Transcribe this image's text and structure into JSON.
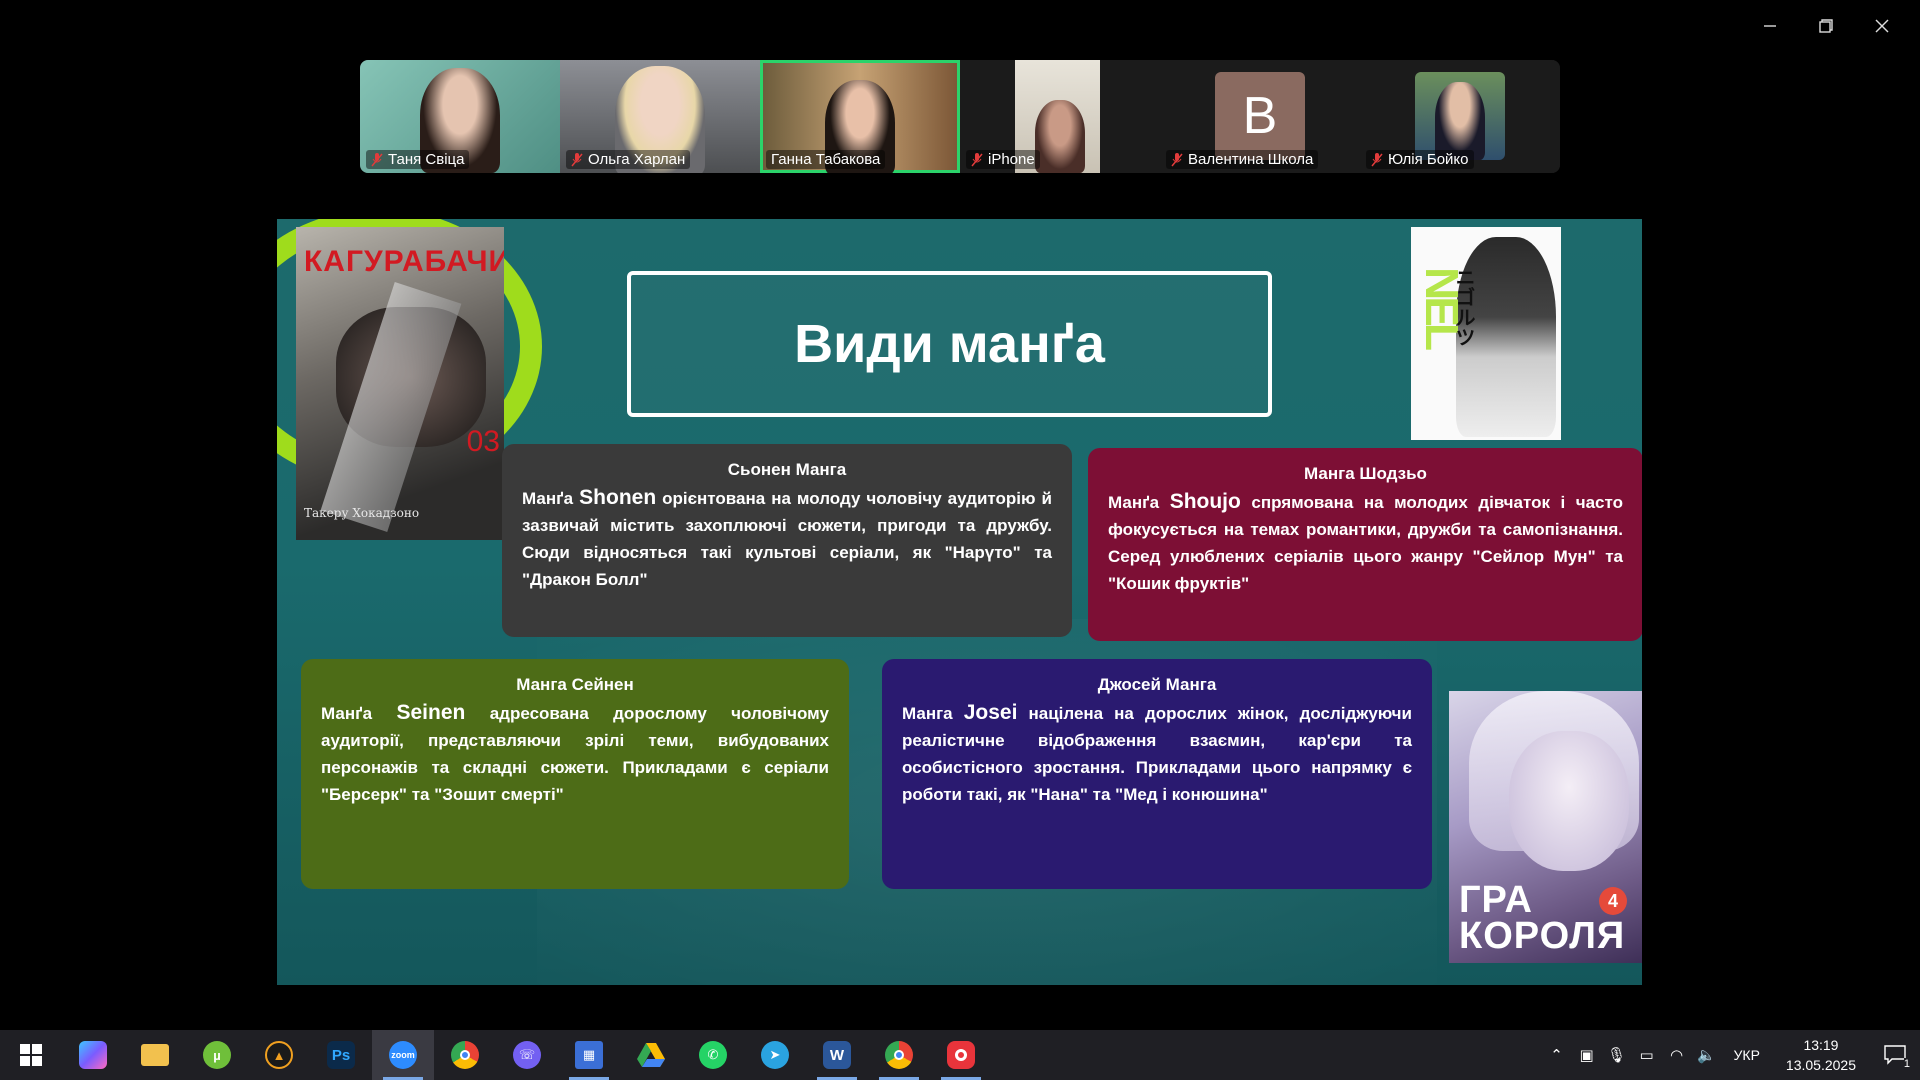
{
  "window": {
    "controls": {
      "minimize": "–",
      "restore": "❐",
      "close": "✕"
    }
  },
  "participants": [
    {
      "name": "Таня Свіца",
      "muted": true,
      "type": "video",
      "bg": "#6fb1a5",
      "active": false
    },
    {
      "name": "Ольга Харлан",
      "muted": true,
      "type": "video",
      "bg": "#7b7d82",
      "active": false
    },
    {
      "name": "Ганна Табакова",
      "muted": false,
      "type": "video",
      "bg": "#a87b55",
      "active": true
    },
    {
      "name": "iPhone",
      "muted": true,
      "type": "video",
      "bg": "#d8d4cc",
      "active": false
    },
    {
      "name": "Валентина Школа",
      "muted": true,
      "type": "letter",
      "letter": "B",
      "active": false
    },
    {
      "name": "Юлія Бойко",
      "muted": true,
      "type": "photo",
      "bg": "#3f6b55",
      "active": false
    }
  ],
  "slide": {
    "title": "Види манґа",
    "covers": {
      "kagura": {
        "title": "КАГУРАБАЧИ",
        "volume": "03",
        "author": "Такеру Хокадзоно"
      },
      "nel": {
        "title": "NEL",
        "jp": "ニゴルツ"
      },
      "gra": {
        "line1": "ГРА",
        "line2": "КОРОЛЯ",
        "volume": "4"
      }
    },
    "cards": {
      "shonen": {
        "heading": "Сьонен Манга",
        "prefix": "Манґа",
        "term": "Shonen",
        "body": "орієнтована на молоду чоловічу аудиторію й зазвичай містить захоплюючі сюжети, пригоди та дружбу. Сюди відносяться такі культові серіали, як \"Нарүто\" та \"Дракон Болл\""
      },
      "shoujo": {
        "heading": "Манга Шодзьо",
        "prefix": "Манґа",
        "term": "Shoujo",
        "body": "спрямована на молодих дівчаток і часто фокусується на темах романтики, дружби та самопізнання. Серед улюблених серіалів цього жанру \"Сейлор Мун\" та \"Кошик фруктів\""
      },
      "seinen": {
        "heading": "Манга Сейнен",
        "prefix": "Манґа",
        "term": "Seinen",
        "body": "адресована дорослому чоловічому аудиторії, представляючи зрілі теми, вибудованих персонажів та складні сюжети. Прикладами є серіали \"Берсерк\" та \"Зошит смерті\""
      },
      "josei": {
        "heading": "Джосей Манга",
        "prefix": "Манга",
        "term": "Josei",
        "body": "націлена на дорослих жінок, досліджуючи реалістичне відображення взаємин, кар'єри та особистісного зростання. Прикладами цього напрямку є роботи такі, як \"Нана\" та \"Мед і конюшина\""
      }
    }
  },
  "taskbar": {
    "apps": [
      {
        "name": "start",
        "icon": "windows-logo-icon"
      },
      {
        "name": "copilot",
        "icon": "copilot-icon",
        "color": "#7a5cff"
      },
      {
        "name": "file-explorer",
        "icon": "folder-icon",
        "color": "#f2c14e"
      },
      {
        "name": "utorrent",
        "icon": "utorrent-icon",
        "color": "#6fbf3a"
      },
      {
        "name": "aimp",
        "icon": "aimp-icon",
        "color": "#f0a020"
      },
      {
        "name": "photoshop",
        "icon": "photoshop-icon",
        "color": "#0b2a4a",
        "label": "Ps"
      },
      {
        "name": "zoom",
        "icon": "zoom-icon",
        "color": "#2d8cff",
        "label": "zoom"
      },
      {
        "name": "chrome",
        "icon": "chrome-icon",
        "color": "#e94235"
      },
      {
        "name": "viber",
        "icon": "viber-icon",
        "color": "#7360f2"
      },
      {
        "name": "floppy",
        "icon": "save-disk-icon",
        "color": "#3b6fd6"
      },
      {
        "name": "google-drive",
        "icon": "drive-icon",
        "color": "#34a853"
      },
      {
        "name": "whatsapp",
        "icon": "whatsapp-icon",
        "color": "#25d366"
      },
      {
        "name": "telegram",
        "icon": "telegram-icon",
        "color": "#2aa3e0"
      },
      {
        "name": "word",
        "icon": "word-icon",
        "color": "#2b579a",
        "label": "W"
      },
      {
        "name": "chrome-profile",
        "icon": "chrome-profile-icon",
        "color": "#e94235"
      },
      {
        "name": "screen-recorder",
        "icon": "recorder-icon",
        "color": "#e8343b"
      }
    ],
    "tray": {
      "language": "УКР",
      "time": "13:19",
      "date": "13.05.2025",
      "notifications": "1"
    }
  }
}
